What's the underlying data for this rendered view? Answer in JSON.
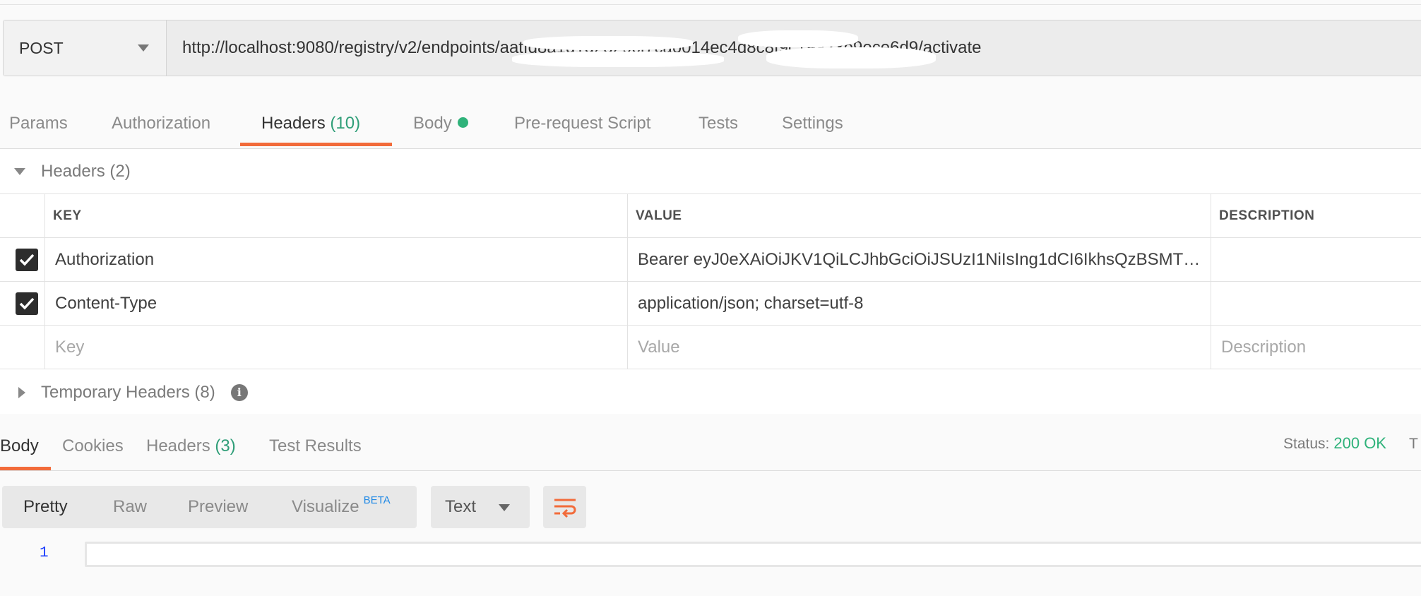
{
  "request": {
    "method": "POST",
    "url": "http://localhost:9080/registry/v2/endpoints/aatfd8a1d1d2529cf7ca0014ec4d8c8f9c19a23e9ece6d9/activate"
  },
  "request_tabs": {
    "params": "Params",
    "authorization": "Authorization",
    "headers": "Headers",
    "headers_count": "(10)",
    "body": "Body",
    "pre_request": "Pre-request Script",
    "tests": "Tests",
    "settings": "Settings"
  },
  "headers_section": {
    "title": "Headers",
    "count": "(2)",
    "columns": {
      "key": "KEY",
      "value": "VALUE",
      "description": "DESCRIPTION"
    },
    "rows": [
      {
        "checked": true,
        "key": "Authorization",
        "value": "Bearer eyJ0eXAiOiJKV1QiLCJhbGciOiJSUzI1NiIsIng1dCI6IkhsQzBSMTJza...",
        "description": ""
      },
      {
        "checked": true,
        "key": "Content-Type",
        "value": "application/json; charset=utf-8",
        "description": ""
      }
    ],
    "placeholders": {
      "key": "Key",
      "value": "Value",
      "description": "Description"
    }
  },
  "temporary_headers": {
    "title": "Temporary Headers",
    "count": "(8)",
    "info_icon": "info-icon"
  },
  "response_tabs": {
    "body": "Body",
    "cookies": "Cookies",
    "headers": "Headers",
    "headers_count": "(3)",
    "test_results": "Test Results"
  },
  "status": {
    "label": "Status:",
    "value": "200 OK",
    "extra": "T"
  },
  "body_view": {
    "formats": [
      "Pretty",
      "Raw",
      "Preview",
      "Visualize"
    ],
    "beta": "BETA",
    "language": "Text",
    "wrap_icon": "wrap-lines-icon"
  },
  "editor": {
    "line_number": "1"
  },
  "colors": {
    "accent": "#f26b3a",
    "success": "#2fb27a",
    "count": "#2f9e78"
  }
}
